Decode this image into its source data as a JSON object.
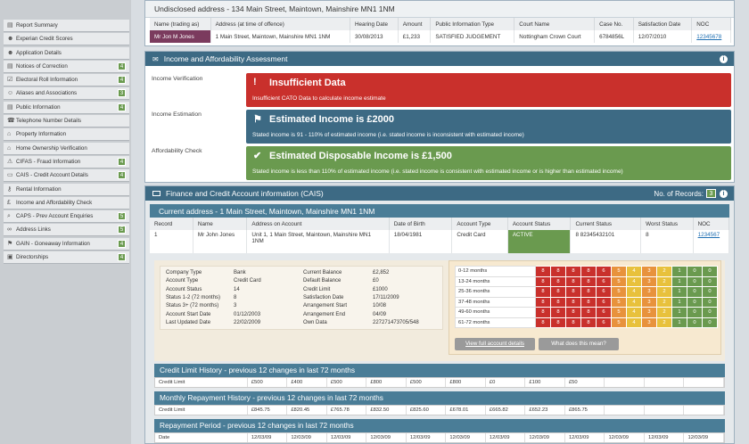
{
  "sidebar": {
    "items": [
      {
        "label": "Report Summary",
        "icon": "document-icon",
        "badge": ""
      },
      {
        "label": "Experian Credit Scores",
        "icon": "user-icon",
        "badge": ""
      },
      {
        "label": "Application Details",
        "icon": "user-icon",
        "badge": ""
      },
      {
        "label": "Notices of Correction",
        "icon": "document-icon",
        "badge": "4"
      },
      {
        "label": "Electoral Roll Information",
        "icon": "ballot-icon",
        "badge": "4"
      },
      {
        "label": "Aliases and Associations",
        "icon": "users-icon",
        "badge": "3"
      },
      {
        "label": "Public Information",
        "icon": "document-icon",
        "badge": "4"
      },
      {
        "label": "Telephone Number Details",
        "icon": "phone-icon",
        "badge": ""
      },
      {
        "label": "Property Information",
        "icon": "home-icon",
        "badge": ""
      },
      {
        "label": "Home Ownership Verification",
        "icon": "home-icon",
        "badge": ""
      },
      {
        "label": "CIFAS - Fraud Information",
        "icon": "warning-icon",
        "badge": "4"
      },
      {
        "label": "CAIS - Credit Account Details",
        "icon": "card-icon",
        "badge": "4"
      },
      {
        "label": "Rental Information",
        "icon": "key-icon",
        "badge": ""
      },
      {
        "label": "Income and Affordability Check",
        "icon": "pound-icon",
        "badge": ""
      },
      {
        "label": "CAPS - Prev Account Enquiries",
        "icon": "search-icon",
        "badge": "5"
      },
      {
        "label": "Address Links",
        "icon": "link-icon",
        "badge": "5"
      },
      {
        "label": "GAIN - Goneaway Information",
        "icon": "flag-icon",
        "badge": "4"
      },
      {
        "label": "Directorships",
        "icon": "briefcase-icon",
        "badge": "4"
      }
    ]
  },
  "undisclosed": {
    "title": "Undisclosed address - 134 Main Street, Maintown, Mainshire MN1 1NM",
    "headers": [
      "Name (trading as)",
      "Address (at time of offence)",
      "Hearing Date",
      "Amount",
      "Public Information Type",
      "Court Name",
      "Case No.",
      "Satisfaction Date",
      "NOC"
    ],
    "row": [
      "Mr Jon M Jones",
      "1 Main Street, Maintown, Mainshire MN1 1NM",
      "30/08/2013",
      "£1,233",
      "SATISFIED JUDGEMENT",
      "Nottingham Crown Court",
      "6784856L",
      "12/07/2010",
      "12345678"
    ]
  },
  "income": {
    "title": "Income and Affordability Assessment",
    "labels": [
      "Income Verification",
      "Income Estimation",
      "Affordability Check"
    ],
    "boxes": [
      {
        "title": "Insufficient Data",
        "text": "Insufficient CATO Data to calculate income estimate",
        "color": "#c9302c",
        "icon": "!"
      },
      {
        "title": "Estimated Income is £2000",
        "text": "Stated income is 91 - 110% of estimated income (i.e. stated income is inconsistent with estimated income)",
        "color": "#3d6a84",
        "icon": "⚑"
      },
      {
        "title": "Estimated Disposable Income is £1,500",
        "text": "Stated income is less than 110% of estimated income (i.e. stated income is consistent with estimated income or is higher than estimated income)",
        "color": "#6a9a4f",
        "icon": "✔"
      }
    ]
  },
  "cais": {
    "title": "Finance and Credit Account information (CAIS)",
    "records_label": "No. of Records:",
    "records": "3",
    "address": "Current address - 1 Main Street, Maintown, Mainshire MN1 1NM",
    "headers": [
      "Record",
      "Name",
      "Address on Account",
      "Date of Birth",
      "Account Type",
      "Account Status",
      "Current Status",
      "Worst Status",
      "NOC"
    ],
    "row": [
      "1",
      "Mr John Jones",
      "Unit 1, 1 Main Street, Maintown, Mainshire MN1 1NM",
      "18/04/1981",
      "Credit Card",
      "ACTIVE",
      "8 82345432101",
      "8",
      "1234567"
    ],
    "details_left": [
      [
        "Company Type",
        "Bank"
      ],
      [
        "Account Type",
        "Credit Card"
      ],
      [
        "Account Status",
        "14"
      ],
      [
        "Status 1-2 (72 months)",
        "8"
      ],
      [
        "Status 3+ (72 months)",
        "3"
      ],
      [
        "Account Start Date",
        "01/12/2003"
      ],
      [
        "Last Updated Date",
        "22/02/2009"
      ]
    ],
    "details_right": [
      [
        "Current Balance",
        "£2,852"
      ],
      [
        "Default Balance",
        "£0"
      ],
      [
        "Credit Limit",
        "£1000"
      ],
      [
        "Satisfaction Date",
        "17/11/2009"
      ],
      [
        "Arrangement Start",
        "10/08"
      ],
      [
        "Arrangement End",
        "04/09"
      ],
      [
        "Own Data",
        "227271473705/548"
      ]
    ],
    "grid_rows": [
      {
        "label": "0-12 months",
        "cells": [
          "8",
          "8",
          "8",
          "8",
          "6",
          "5",
          "4",
          "3",
          "2",
          "1",
          "0",
          "0"
        ]
      },
      {
        "label": "13-24 months",
        "cells": [
          "8",
          "8",
          "8",
          "8",
          "6",
          "5",
          "4",
          "3",
          "2",
          "1",
          "0",
          "0"
        ]
      },
      {
        "label": "25-36 months",
        "cells": [
          "8",
          "8",
          "8",
          "8",
          "6",
          "5",
          "4",
          "3",
          "2",
          "1",
          "0",
          "0"
        ]
      },
      {
        "label": "37-48 months",
        "cells": [
          "8",
          "8",
          "8",
          "8",
          "6",
          "5",
          "4",
          "3",
          "2",
          "1",
          "0",
          "0"
        ]
      },
      {
        "label": "49-60 months",
        "cells": [
          "8",
          "8",
          "8",
          "8",
          "6",
          "5",
          "4",
          "3",
          "2",
          "1",
          "0",
          "0"
        ]
      },
      {
        "label": "61-72 months",
        "cells": [
          "8",
          "8",
          "8",
          "8",
          "6",
          "5",
          "4",
          "3",
          "2",
          "1",
          "0",
          "0"
        ]
      }
    ],
    "view_btn": "View full account details",
    "what_btn": "What does this mean?"
  },
  "histories": [
    {
      "title": "Credit Limit History - previous 12 changes in last 72 months",
      "label": "Credit Limit",
      "values": [
        "£500",
        "£400",
        "£500",
        "£800",
        "£500",
        "£800",
        "£0",
        "£100",
        "£50",
        "",
        "",
        ""
      ]
    },
    {
      "title": "Monthly Repayment History - previous 12 changes in last 72 months",
      "label": "Credit Limit",
      "values": [
        "£845.75",
        "£820.45",
        "£765.78",
        "£832.50",
        "£825.60",
        "£678.01",
        "£665.82",
        "£652.23",
        "£865.75",
        "",
        "",
        ""
      ]
    },
    {
      "title": "Repayment Period - previous 12 changes in last 72 months",
      "label": "Date",
      "values": [
        "12/03/09",
        "12/03/09",
        "12/03/09",
        "12/03/09",
        "12/03/09",
        "12/03/09",
        "12/03/09",
        "12/03/09",
        "12/03/09",
        "12/03/09",
        "12/03/09",
        "12/03/09"
      ]
    }
  ],
  "colors": {
    "red": "#c9302c",
    "orange": "#e8923c",
    "yellow": "#e8c13c",
    "green": "#6a9a4f"
  }
}
